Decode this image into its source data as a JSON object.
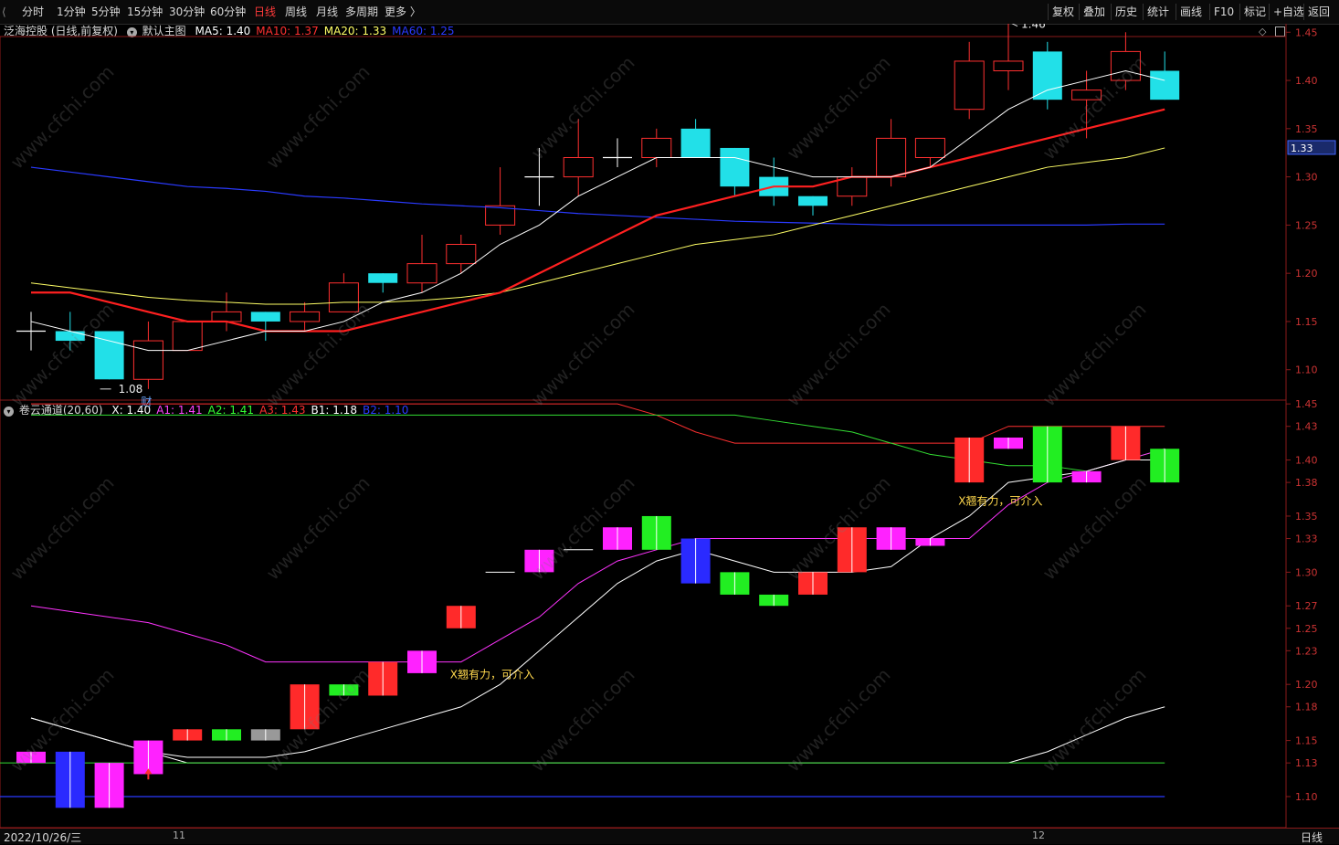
{
  "toolbar": {
    "left": [
      "分时",
      "1分钟",
      "5分钟",
      "15分钟",
      "30分钟",
      "60分钟",
      "日线",
      "周线",
      "月线",
      "多周期",
      "更多 〉"
    ],
    "active_index": 6,
    "right": [
      "复权",
      "叠加",
      "历史",
      "统计",
      "画线",
      "F10",
      "标记",
      "+自选",
      "返回"
    ]
  },
  "main": {
    "stock": "泛海控股 (日线,前复权)",
    "template": "默认主图",
    "ma": [
      {
        "label": "MA5:",
        "value": "1.40",
        "color": "#ffffff"
      },
      {
        "label": "MA10:",
        "value": "1.37",
        "color": "#ff3030"
      },
      {
        "label": "MA20:",
        "value": "1.33",
        "color": "#ffff66"
      },
      {
        "label": "MA60:",
        "value": "1.25",
        "color": "#2a3aff"
      }
    ],
    "high_label": "1.46",
    "low_label": "1.08",
    "cai_label": "财",
    "price_tag": "1.33",
    "yticks": [
      "1.45",
      "1.40",
      "1.35",
      "1.30",
      "1.25",
      "1.20",
      "1.15",
      "1.10"
    ]
  },
  "sub": {
    "title": "卷云通道(20,60)",
    "items": [
      {
        "label": "X:",
        "value": "1.40",
        "color": "#ffffff"
      },
      {
        "label": "A1:",
        "value": "1.41",
        "color": "#ff44ff"
      },
      {
        "label": "A2:",
        "value": "1.41",
        "color": "#33ff33"
      },
      {
        "label": "A3:",
        "value": "1.43",
        "color": "#ff3030"
      },
      {
        "label": "B1:",
        "value": "1.18",
        "color": "#ffffff"
      },
      {
        "label": "B2:",
        "value": "1.10",
        "color": "#2a3aff"
      }
    ],
    "signal_text": "X翘有力，可介入",
    "yticks": [
      "1.45",
      "1.43",
      "1.40",
      "1.38",
      "1.35",
      "1.33",
      "1.30",
      "1.27",
      "1.25",
      "1.23",
      "1.20",
      "1.18",
      "1.15",
      "1.13",
      "1.10"
    ]
  },
  "footer": {
    "date": "2022/10/26/三",
    "month1": "11",
    "month2": "12",
    "period": "日线"
  },
  "watermark": "www.cfchi.com",
  "chart_data": [
    {
      "type": "candlestick",
      "title": "泛海控股 (日线,前复权)",
      "ylim": [
        1.06,
        1.48
      ],
      "candles": [
        {
          "o": 1.14,
          "h": 1.16,
          "l": 1.12,
          "c": 1.14
        },
        {
          "o": 1.14,
          "h": 1.16,
          "l": 1.12,
          "c": 1.13
        },
        {
          "o": 1.14,
          "h": 1.14,
          "l": 1.09,
          "c": 1.09
        },
        {
          "o": 1.09,
          "h": 1.15,
          "l": 1.08,
          "c": 1.13
        },
        {
          "o": 1.12,
          "h": 1.15,
          "l": 1.12,
          "c": 1.15
        },
        {
          "o": 1.15,
          "h": 1.18,
          "l": 1.14,
          "c": 1.16
        },
        {
          "o": 1.16,
          "h": 1.16,
          "l": 1.13,
          "c": 1.15
        },
        {
          "o": 1.15,
          "h": 1.17,
          "l": 1.14,
          "c": 1.16
        },
        {
          "o": 1.16,
          "h": 1.2,
          "l": 1.16,
          "c": 1.19
        },
        {
          "o": 1.2,
          "h": 1.2,
          "l": 1.18,
          "c": 1.19
        },
        {
          "o": 1.19,
          "h": 1.24,
          "l": 1.18,
          "c": 1.21
        },
        {
          "o": 1.21,
          "h": 1.24,
          "l": 1.2,
          "c": 1.23
        },
        {
          "o": 1.25,
          "h": 1.31,
          "l": 1.24,
          "c": 1.27
        },
        {
          "o": 1.3,
          "h": 1.33,
          "l": 1.27,
          "c": 1.3
        },
        {
          "o": 1.3,
          "h": 1.36,
          "l": 1.28,
          "c": 1.32
        },
        {
          "o": 1.32,
          "h": 1.34,
          "l": 1.31,
          "c": 1.32
        },
        {
          "o": 1.32,
          "h": 1.35,
          "l": 1.31,
          "c": 1.34
        },
        {
          "o": 1.35,
          "h": 1.36,
          "l": 1.32,
          "c": 1.32
        },
        {
          "o": 1.33,
          "h": 1.33,
          "l": 1.28,
          "c": 1.29
        },
        {
          "o": 1.3,
          "h": 1.32,
          "l": 1.27,
          "c": 1.28
        },
        {
          "o": 1.28,
          "h": 1.28,
          "l": 1.26,
          "c": 1.27
        },
        {
          "o": 1.28,
          "h": 1.31,
          "l": 1.27,
          "c": 1.3
        },
        {
          "o": 1.3,
          "h": 1.36,
          "l": 1.29,
          "c": 1.34
        },
        {
          "o": 1.32,
          "h": 1.34,
          "l": 1.31,
          "c": 1.34
        },
        {
          "o": 1.37,
          "h": 1.44,
          "l": 1.36,
          "c": 1.42
        },
        {
          "o": 1.41,
          "h": 1.46,
          "l": 1.39,
          "c": 1.42
        },
        {
          "o": 1.43,
          "h": 1.44,
          "l": 1.37,
          "c": 1.38
        },
        {
          "o": 1.38,
          "h": 1.41,
          "l": 1.34,
          "c": 1.39
        },
        {
          "o": 1.4,
          "h": 1.45,
          "l": 1.39,
          "c": 1.43
        },
        {
          "o": 1.41,
          "h": 1.43,
          "l": 1.38,
          "c": 1.38
        }
      ],
      "ma5": [
        1.15,
        1.14,
        1.13,
        1.12,
        1.12,
        1.13,
        1.14,
        1.14,
        1.15,
        1.17,
        1.18,
        1.2,
        1.23,
        1.25,
        1.28,
        1.3,
        1.32,
        1.32,
        1.32,
        1.31,
        1.3,
        1.3,
        1.3,
        1.31,
        1.34,
        1.37,
        1.39,
        1.4,
        1.41,
        1.4
      ],
      "ma10": [
        1.18,
        1.18,
        1.17,
        1.16,
        1.15,
        1.15,
        1.14,
        1.14,
        1.14,
        1.15,
        1.16,
        1.17,
        1.18,
        1.2,
        1.22,
        1.24,
        1.26,
        1.27,
        1.28,
        1.29,
        1.29,
        1.3,
        1.3,
        1.31,
        1.32,
        1.33,
        1.34,
        1.35,
        1.36,
        1.37
      ],
      "ma20": [
        1.19,
        1.185,
        1.18,
        1.175,
        1.172,
        1.17,
        1.168,
        1.168,
        1.17,
        1.17,
        1.172,
        1.175,
        1.18,
        1.19,
        1.2,
        1.21,
        1.22,
        1.23,
        1.235,
        1.24,
        1.25,
        1.26,
        1.27,
        1.28,
        1.29,
        1.3,
        1.31,
        1.315,
        1.32,
        1.33
      ],
      "ma60": [
        1.31,
        1.305,
        1.3,
        1.295,
        1.29,
        1.288,
        1.285,
        1.28,
        1.278,
        1.275,
        1.272,
        1.27,
        1.268,
        1.265,
        1.262,
        1.26,
        1.258,
        1.256,
        1.254,
        1.253,
        1.252,
        1.251,
        1.25,
        1.25,
        1.25,
        1.25,
        1.25,
        1.25,
        1.251,
        1.251
      ]
    },
    {
      "type": "candlestick",
      "title": "卷云通道(20,60)",
      "ylim": [
        1.09,
        1.465
      ],
      "bars": [
        {
          "o": 1.14,
          "c": 1.13,
          "color": "magenta"
        },
        {
          "o": 1.14,
          "c": 1.09,
          "color": "blue"
        },
        {
          "o": 1.13,
          "c": 1.09,
          "color": "magenta"
        },
        {
          "o": 1.15,
          "c": 1.12,
          "color": "magenta"
        },
        {
          "o": 1.16,
          "c": 1.15,
          "color": "red"
        },
        {
          "o": 1.16,
          "c": 1.15,
          "color": "green"
        },
        {
          "o": 1.16,
          "c": 1.15,
          "color": "gray"
        },
        {
          "o": 1.2,
          "c": 1.16,
          "color": "red"
        },
        {
          "o": 1.2,
          "c": 1.19,
          "color": "green"
        },
        {
          "o": 1.22,
          "c": 1.19,
          "color": "red"
        },
        {
          "o": 1.23,
          "c": 1.21,
          "color": "magenta"
        },
        {
          "o": 1.27,
          "c": 1.25,
          "color": "red"
        },
        {
          "o": 1.3,
          "c": 1.3,
          "color": "white"
        },
        {
          "o": 1.32,
          "c": 1.3,
          "color": "magenta"
        },
        {
          "o": 1.32,
          "c": 1.32,
          "color": "white"
        },
        {
          "o": 1.34,
          "c": 1.32,
          "color": "magenta"
        },
        {
          "o": 1.35,
          "c": 1.32,
          "color": "green"
        },
        {
          "o": 1.33,
          "c": 1.29,
          "color": "blue"
        },
        {
          "o": 1.3,
          "c": 1.28,
          "color": "green"
        },
        {
          "o": 1.28,
          "c": 1.27,
          "color": "green"
        },
        {
          "o": 1.3,
          "c": 1.28,
          "color": "red"
        },
        {
          "o": 1.34,
          "c": 1.3,
          "color": "red"
        },
        {
          "o": 1.34,
          "c": 1.32,
          "color": "magenta"
        },
        {
          "o": 1.33,
          "c": 1.33,
          "color": "magenta"
        },
        {
          "o": 1.42,
          "c": 1.38,
          "color": "red"
        },
        {
          "o": 1.42,
          "c": 1.41,
          "color": "magenta"
        },
        {
          "o": 1.43,
          "c": 1.38,
          "color": "green"
        },
        {
          "o": 1.39,
          "c": 1.38,
          "color": "magenta"
        },
        {
          "o": 1.43,
          "c": 1.4,
          "color": "red"
        },
        {
          "o": 1.41,
          "c": 1.38,
          "color": "green"
        }
      ],
      "A1": [
        1.27,
        1.265,
        1.26,
        1.255,
        1.245,
        1.235,
        1.22,
        1.22,
        1.22,
        1.22,
        1.22,
        1.22,
        1.24,
        1.26,
        1.29,
        1.31,
        1.32,
        1.33,
        1.33,
        1.33,
        1.33,
        1.33,
        1.33,
        1.33,
        1.33,
        1.36,
        1.38,
        1.39,
        1.4,
        1.41
      ],
      "A2": [
        1.44,
        1.44,
        1.44,
        1.44,
        1.44,
        1.44,
        1.44,
        1.44,
        1.44,
        1.44,
        1.44,
        1.44,
        1.44,
        1.44,
        1.44,
        1.44,
        1.44,
        1.44,
        1.44,
        1.435,
        1.43,
        1.425,
        1.415,
        1.405,
        1.4,
        1.395,
        1.395,
        1.39,
        1.4,
        1.41
      ],
      "A3": [
        1.45,
        1.45,
        1.45,
        1.45,
        1.45,
        1.45,
        1.45,
        1.45,
        1.45,
        1.45,
        1.45,
        1.45,
        1.45,
        1.45,
        1.45,
        1.45,
        1.44,
        1.425,
        1.415,
        1.415,
        1.415,
        1.415,
        1.415,
        1.415,
        1.415,
        1.43,
        1.43,
        1.43,
        1.43,
        1.43
      ],
      "B1": [
        1.17,
        1.16,
        1.15,
        1.14,
        1.135,
        1.135,
        1.135,
        1.14,
        1.15,
        1.16,
        1.17,
        1.18,
        1.2,
        1.23,
        1.26,
        1.29,
        1.31,
        1.32,
        1.31,
        1.3,
        1.3,
        1.3,
        1.305,
        1.33,
        1.35,
        1.38,
        1.385,
        1.39,
        1.4,
        1.4
      ],
      "B2": [
        1.1,
        1.1,
        1.1,
        1.1,
        1.1,
        1.1,
        1.1,
        1.1,
        1.1,
        1.1,
        1.1,
        1.1,
        1.1,
        1.1,
        1.1,
        1.1,
        1.1,
        1.1,
        1.1,
        1.1,
        1.1,
        1.1,
        1.1,
        1.1,
        1.1,
        1.1,
        1.1,
        1.1,
        1.1,
        1.1
      ],
      "B1_lower": [
        1.17,
        1.16,
        1.15,
        1.14,
        1.13,
        1.13,
        1.13,
        1.13,
        1.13,
        1.13,
        1.13,
        1.13,
        1.13,
        1.13,
        1.13,
        1.13,
        1.13,
        1.13,
        1.13,
        1.13,
        1.13,
        1.13,
        1.13,
        1.13,
        1.13,
        1.13,
        1.14,
        1.155,
        1.17,
        1.18
      ],
      "signals": [
        11,
        24
      ]
    }
  ]
}
